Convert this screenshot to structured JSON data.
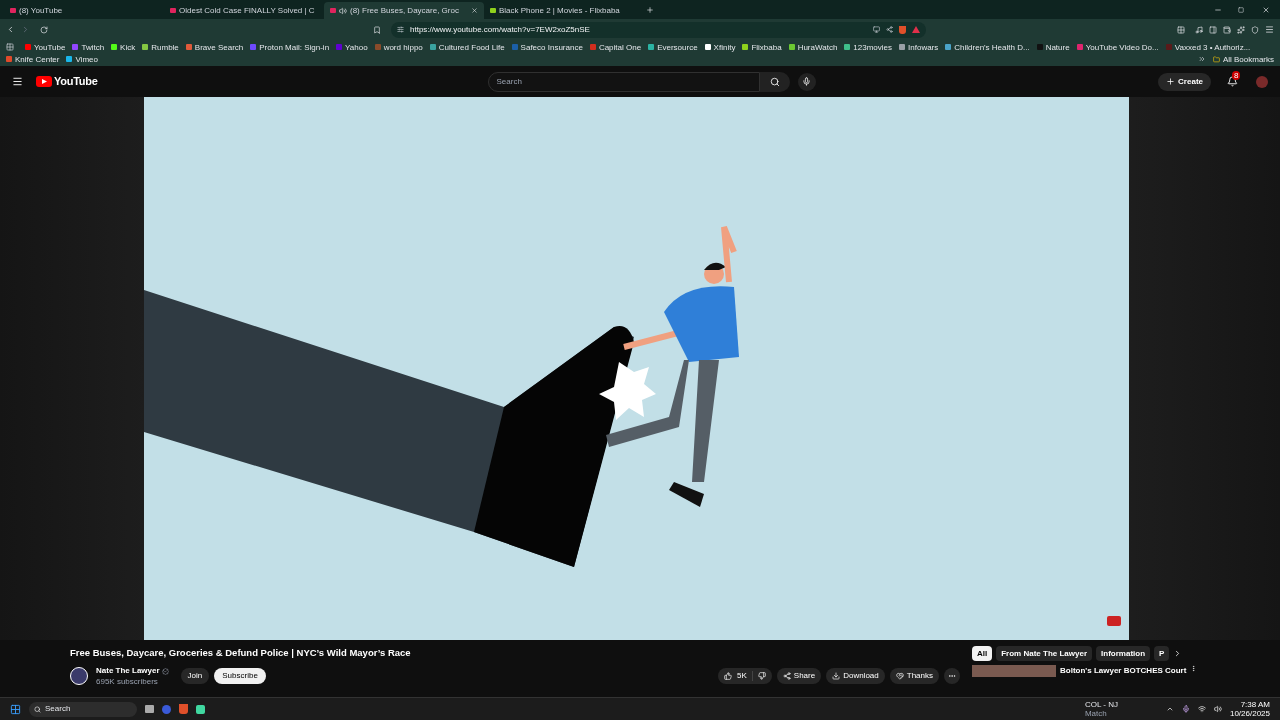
{
  "tabs": [
    {
      "title": "(8) YouTube",
      "selected": false,
      "audio": false
    },
    {
      "title": "Oldest Cold Case FINALLY Solved | C",
      "selected": false,
      "audio": false
    },
    {
      "title": "(8) Free Buses, Daycare, Groc",
      "selected": true,
      "audio": true
    },
    {
      "title": "Black Phone 2 | Movies - Flixbaba",
      "selected": false,
      "audio": false
    }
  ],
  "address_bar": {
    "url": "https://www.youtube.com/watch?v=7EW2xoZ5nSE"
  },
  "bookmarks": [
    {
      "label": "YouTube",
      "color": "#ff0000"
    },
    {
      "label": "Twitch",
      "color": "#9146ff"
    },
    {
      "label": "Kick",
      "color": "#53fc18"
    },
    {
      "label": "Rumble",
      "color": "#85c742"
    },
    {
      "label": "Brave Search",
      "color": "#e05a3a"
    },
    {
      "label": "Proton Mail: Sign-in",
      "color": "#6d4aff"
    },
    {
      "label": "Yahoo",
      "color": "#6001d2"
    },
    {
      "label": "word hippo",
      "color": "#8a4b2a"
    },
    {
      "label": "Cultured Food Life",
      "color": "#3aa3a0"
    },
    {
      "label": "Safeco Insurance",
      "color": "#1b5fa8"
    },
    {
      "label": "Capital One",
      "color": "#d22e1e"
    },
    {
      "label": "Eversource",
      "color": "#2bb3a3"
    },
    {
      "label": "Xfinity",
      "color": "#ffffff"
    },
    {
      "label": "Flixbaba",
      "color": "#8fd11c"
    },
    {
      "label": "HuraWatch",
      "color": "#6cc832"
    },
    {
      "label": "123movies",
      "color": "#3fbf8a"
    },
    {
      "label": "Infowars",
      "color": "#9aa0a6"
    },
    {
      "label": "Children's Health D...",
      "color": "#4aa3c8"
    },
    {
      "label": "Nature",
      "color": "#111111"
    },
    {
      "label": "YouTube Video Do...",
      "color": "#e0246e"
    },
    {
      "label": "Vaxxed 3 • Authoriz...",
      "color": "#5a1a1a"
    },
    {
      "label": "Knife Center",
      "color": "#e04a2a"
    },
    {
      "label": "Vimeo",
      "color": "#1ab7ea"
    }
  ],
  "all_bookmarks": "All Bookmarks",
  "youtube": {
    "logo": "YouTube",
    "search": {
      "placeholder": "Search"
    },
    "create": "Create",
    "notifications": "8"
  },
  "video": {
    "title": "Free Buses, Daycare, Groceries & Defund Police | NYC’s Wild Mayor’s Race",
    "channel": "Nate The Lawyer",
    "subscribers": "695K subscribers",
    "join": "Join",
    "subscribe": "Subscribe",
    "likes": "5K",
    "share": "Share",
    "download": "Download",
    "thanks": "Thanks"
  },
  "chips": [
    {
      "label": "All",
      "selected": true
    },
    {
      "label": "From Nate The Lawyer",
      "selected": false
    },
    {
      "label": "Information",
      "selected": false
    },
    {
      "label": "P",
      "selected": false
    }
  ],
  "recommended": [
    {
      "title": "Bolton's Lawyer BOTCHES Court"
    }
  ],
  "taskbar": {
    "search": "Search",
    "sports_title": "COL - NJ",
    "sports_sub": "Match",
    "time": "7:38 AM",
    "date": "10/26/2025"
  }
}
